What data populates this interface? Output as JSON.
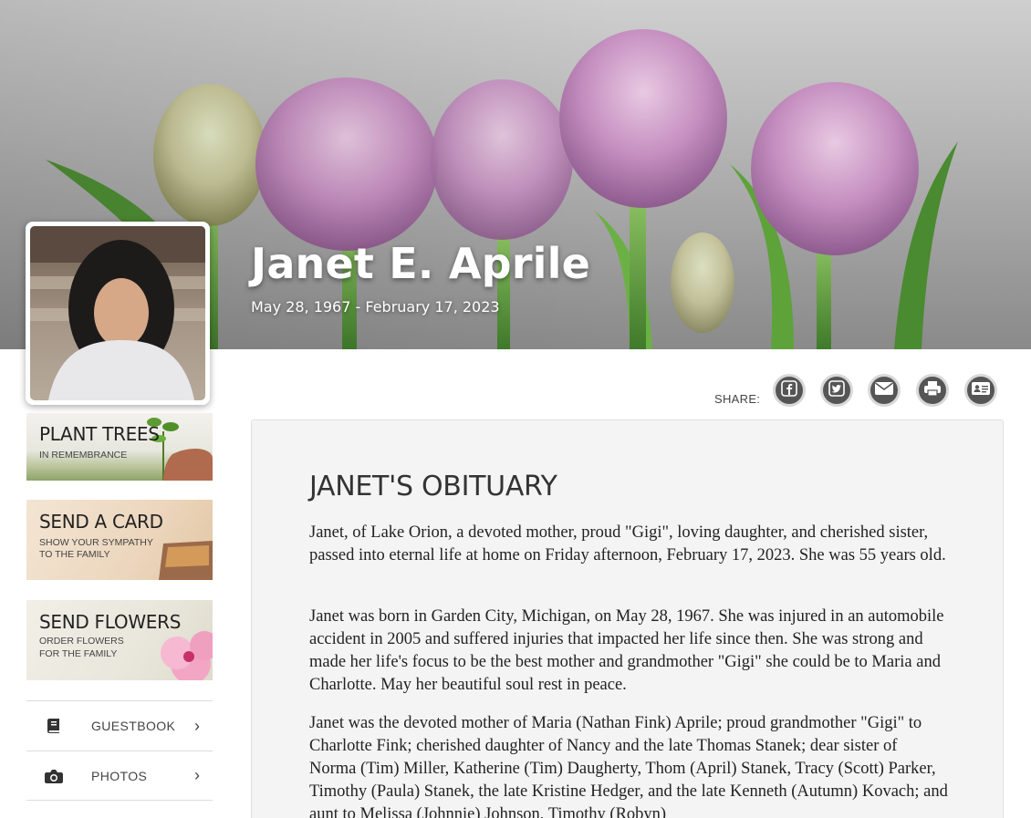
{
  "hero": {
    "name": "Janet E. Aprile",
    "dates": "May 28, 1967 - February 17, 2023"
  },
  "promos": {
    "trees": {
      "title": "PLANT TREES",
      "sub": "IN REMEMBRANCE"
    },
    "card": {
      "title": "SEND A CARD",
      "sub1": "SHOW YOUR SYMPATHY",
      "sub2": "TO THE FAMILY"
    },
    "flowers": {
      "title": "SEND FLOWERS",
      "sub1": "ORDER FLOWERS",
      "sub2": "FOR THE FAMILY"
    }
  },
  "nav": {
    "guestbook": {
      "label": "GUESTBOOK",
      "icon": "book-icon"
    },
    "photos": {
      "label": "PHOTOS",
      "icon": "camera-icon"
    }
  },
  "share": {
    "label": "SHARE:",
    "buttons": [
      "facebook-icon",
      "twitter-icon",
      "email-icon",
      "print-icon",
      "vcard-icon"
    ]
  },
  "obituary": {
    "title": "JANET'S OBITUARY",
    "p1": "Janet, of Lake Orion, a devoted mother, proud \"Gigi\", loving daughter, and cherished sister, passed into eternal life at home on Friday afternoon, February 17, 2023.  She was 55 years old.",
    "p2": "Janet was born in Garden City, Michigan, on May 28, 1967.  She was injured in an automobile accident in 2005 and suffered injuries that impacted her life since then.  She was strong and made her life's focus to be the best mother and grandmother \"Gigi\" she could be to Maria and Charlotte.  May her beautiful soul rest in peace.",
    "p3": "Janet was the devoted mother of Maria (Nathan Fink) Aprile; proud grandmother \"Gigi\" to Charlotte Fink; cherished daughter of Nancy and the late Thomas Stanek; dear sister of Norma (Tim) Miller, Katherine (Tim) Daugherty, Thom (April) Stanek, Tracy (Scott) Parker, Timothy (Paula) Stanek, the late Kristine Hedger, and the late Kenneth (Autumn) Kovach; and aunt to Melissa (Johnnie) Johnson, Timothy (Robyn)"
  },
  "colors": {
    "tulip": "#c58fc0",
    "stem": "#5e9a3a",
    "icon_bg": "#555555"
  }
}
